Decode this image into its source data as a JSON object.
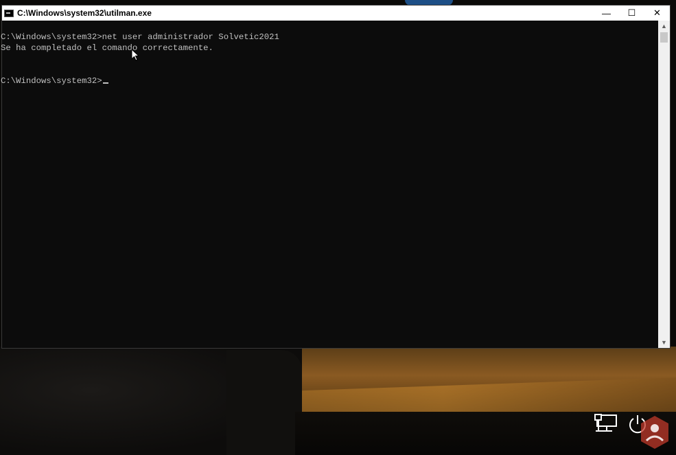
{
  "window": {
    "title": "C:\\Windows\\system32\\utilman.exe",
    "controls": {
      "minimize": "—",
      "maximize": "☐",
      "close": "✕"
    }
  },
  "console": {
    "lines": [
      "C:\\Windows\\system32>net user administrador Solvetic2021",
      "Se ha completado el comando correctamente.",
      "",
      "C:\\Windows\\system32>"
    ]
  },
  "scrollbar": {
    "up": "▲",
    "down": "▼"
  },
  "lockscreen": {
    "icons": [
      "network-icon",
      "power-icon"
    ]
  },
  "colors": {
    "console_bg": "#0c0c0c",
    "console_text": "#c0c0c0",
    "titlebar_bg": "#ffffff"
  }
}
